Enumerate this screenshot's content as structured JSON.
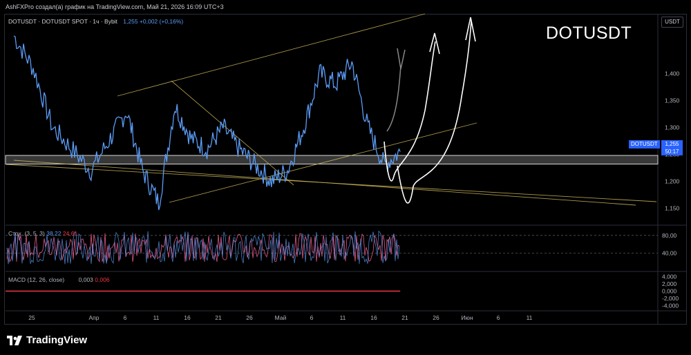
{
  "header": {
    "caption": "AshFXPro создал(а) график на TradingView.com, Май 21, 2026 16:09 UTC+3"
  },
  "legend": {
    "symbol": "DOTUSDT · DOTUSDT SPOT · 1ч · Bybit",
    "values": "1,255 +0,002 (+0,16%)"
  },
  "big_symbol": "DOTUSDT",
  "currency": "USDT",
  "badges": {
    "symbol": "DOTUSDT",
    "price": "1,255",
    "countdown": "50:17"
  },
  "stoch": {
    "label": "Стох. (3, 5, 3)",
    "k": "38,22",
    "d": "24,61"
  },
  "macd": {
    "label": "MACD (12, 26, close)",
    "macd": "0,003",
    "signal": "0,006"
  },
  "brand": "TradingView",
  "colors": {
    "price_line": "#5b9cf6",
    "trendline": "#c9b458",
    "zone": "#d9d9d9",
    "stoch_k": "#5b9cf6",
    "stoch_d": "#e05a8a",
    "macd": "#f23645"
  },
  "chart_data": {
    "type": "line",
    "price_axis": {
      "ticks": [
        "1,400",
        "1,350",
        "1,300",
        "1,250",
        "1,200",
        "1,150"
      ],
      "values": [
        1.4,
        1.35,
        1.3,
        1.25,
        1.2,
        1.15
      ],
      "range": [
        1.12,
        1.485
      ]
    },
    "stoch_axis": {
      "ticks": [
        "80,00",
        "40,00"
      ],
      "values": [
        80,
        40
      ],
      "range": [
        0,
        100
      ]
    },
    "macd_axis": {
      "ticks": [
        "4,000",
        "2,000",
        "0,000",
        "-2,000",
        "-4,000"
      ],
      "values": [
        4,
        2,
        0,
        -2,
        -4
      ],
      "range": [
        -5,
        5
      ]
    },
    "time_axis": [
      "25",
      "Апр",
      "6",
      "11",
      "16",
      "21",
      "26",
      "Май",
      "6",
      "11",
      "16",
      "21",
      "26",
      "Июн",
      "6",
      "11"
    ],
    "time_index": [
      0,
      2,
      3,
      4,
      5,
      6,
      7,
      8,
      9,
      10,
      11,
      12,
      13,
      14,
      15,
      16
    ],
    "x": [
      0,
      0.6,
      1.2,
      1.8,
      2.4,
      3.0,
      3.5,
      4.0,
      4.5,
      5.0,
      5.5,
      6.0,
      6.5,
      7.0,
      7.5,
      8.0,
      8.5,
      9.0,
      9.5,
      10.0,
      10.5,
      11.0,
      11.5,
      12.0
    ],
    "values": [
      1.47,
      1.41,
      1.3,
      1.26,
      1.22,
      1.28,
      1.33,
      1.22,
      1.16,
      1.34,
      1.28,
      1.26,
      1.3,
      1.26,
      1.23,
      1.2,
      1.22,
      1.3,
      1.4,
      1.38,
      1.42,
      1.3,
      1.23,
      1.255
    ],
    "series": [
      {
        "values": [
          1.47,
          1.41,
          1.3,
          1.26,
          1.22,
          1.28,
          1.33,
          1.22,
          1.16,
          1.34,
          1.28,
          1.26,
          1.3,
          1.26,
          1.23,
          1.2,
          1.22,
          1.3,
          1.4,
          1.38,
          1.42,
          1.3,
          1.23,
          1.255
        ]
      }
    ],
    "zone": [
      1.232,
      1.248
    ],
    "grid": false
  }
}
